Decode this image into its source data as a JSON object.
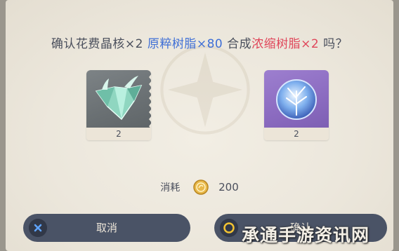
{
  "dialog": {
    "prompt": {
      "part1": "确认花费晶核×2 ",
      "item1": "原粹树脂×80",
      "part2": " 合成",
      "item2": "浓缩树脂×2",
      "part3": " 吗？"
    },
    "cards": [
      {
        "name": "crystal-core",
        "count": "2"
      },
      {
        "name": "condensed-resin",
        "count": "2"
      }
    ],
    "cost": {
      "label": "消耗",
      "value": "200",
      "icon": "mora-coin-icon"
    },
    "buttons": {
      "cancel": {
        "label": "取消",
        "icon": "x-circle-icon"
      },
      "confirm": {
        "label": "确认",
        "icon": "o-circle-icon"
      }
    }
  },
  "watermark": "承通手游资讯网",
  "colors": {
    "highlight_blue": "#3f6fd6",
    "highlight_red": "#e0465a",
    "button_bg": "#4a5366",
    "card_grey": "#6a7073",
    "card_purple": "#8b6bc0"
  }
}
